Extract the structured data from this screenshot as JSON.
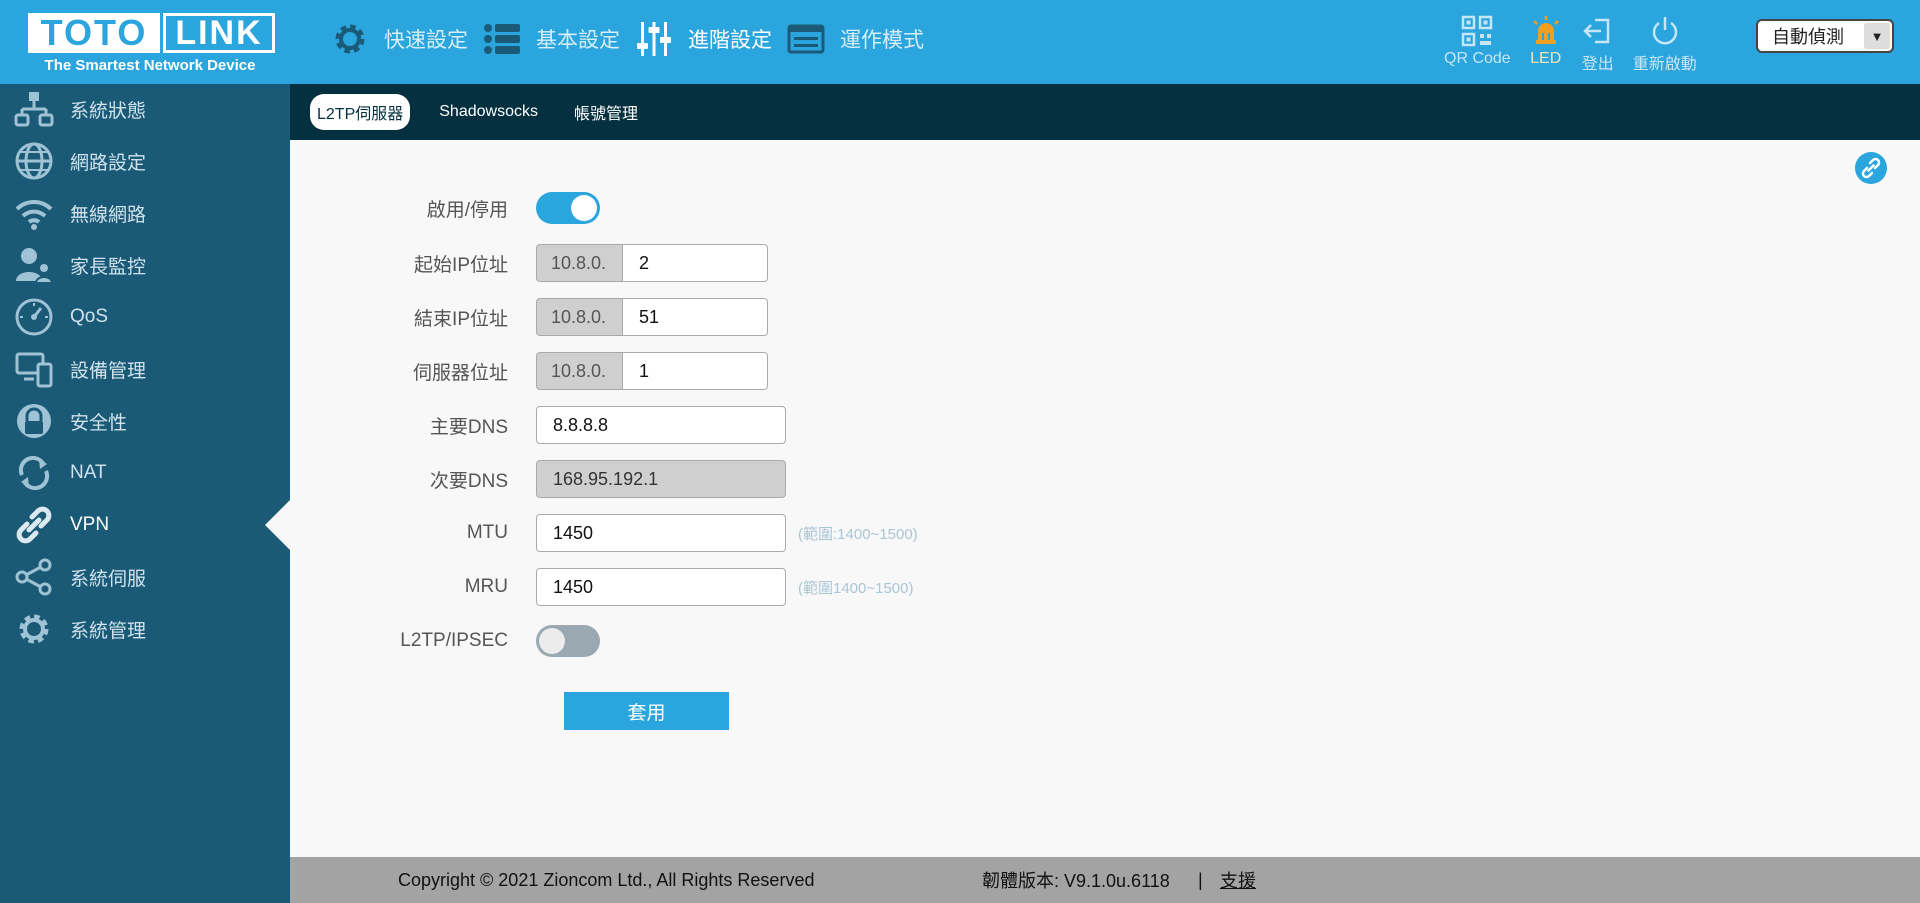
{
  "header": {
    "logo_left": "TOTO",
    "logo_right": "LINK",
    "tagline": "The Smartest Network Device",
    "nav": [
      {
        "label": "快速設定",
        "icon": "gear-icon"
      },
      {
        "label": "基本設定",
        "icon": "list-icon"
      },
      {
        "label": "進階設定",
        "icon": "sliders-icon"
      },
      {
        "label": "運作模式",
        "icon": "router-mode-icon"
      }
    ],
    "tools": [
      {
        "label": "QR Code",
        "icon": "qrcode-icon"
      },
      {
        "label": "LED",
        "icon": "led-icon"
      },
      {
        "label": "登出",
        "icon": "logout-icon"
      },
      {
        "label": "重新啟動",
        "icon": "power-icon"
      }
    ],
    "language": "自動偵測"
  },
  "sidebar": {
    "items": [
      {
        "label": "系統狀態",
        "icon": "network-status-icon"
      },
      {
        "label": "網路設定",
        "icon": "globe-icon"
      },
      {
        "label": "無線網路",
        "icon": "wifi-icon"
      },
      {
        "label": "家長監控",
        "icon": "parental-control-icon"
      },
      {
        "label": "QoS",
        "icon": "speedometer-icon"
      },
      {
        "label": "設備管理",
        "icon": "devices-icon"
      },
      {
        "label": "安全性",
        "icon": "lock-icon"
      },
      {
        "label": "NAT",
        "icon": "refresh-icon"
      },
      {
        "label": "VPN",
        "icon": "link-icon"
      },
      {
        "label": "系統伺服",
        "icon": "share-icon"
      },
      {
        "label": "系統管理",
        "icon": "settings-icon"
      }
    ],
    "active_index": 8
  },
  "tabs": [
    {
      "label": "L2TP伺服器"
    },
    {
      "label": "Shadowsocks"
    },
    {
      "label": "帳號管理"
    }
  ],
  "form": {
    "enable_label": "啟用/停用",
    "enable_on": true,
    "start_ip_label": "起始IP位址",
    "start_ip_prefix": "10.8.0.",
    "start_ip_value": "2",
    "end_ip_label": "結束IP位址",
    "end_ip_prefix": "10.8.0.",
    "end_ip_value": "51",
    "server_ip_label": "伺服器位址",
    "server_ip_prefix": "10.8.0.",
    "server_ip_value": "1",
    "primary_dns_label": "主要DNS",
    "primary_dns_value": "8.8.8.8",
    "secondary_dns_label": "次要DNS",
    "secondary_dns_value": "168.95.192.1",
    "mtu_label": "MTU",
    "mtu_value": "1450",
    "mtu_hint": "(範圍:1400~1500)",
    "mru_label": "MRU",
    "mru_value": "1450",
    "mru_hint": "(範圍1400~1500)",
    "ipsec_label": "L2TP/IPSEC",
    "ipsec_on": false,
    "apply_label": "套用"
  },
  "footer": {
    "copyright": "Copyright © 2021 Zioncom Ltd., All Rights Reserved",
    "firmware": "韌體版本: V9.1.0u.6118",
    "separator": "|",
    "support": "支援"
  },
  "colors": {
    "header_bg": "#2aa5dd",
    "sidebar_bg": "#1b5a77",
    "subtab_bg": "#05303f",
    "accent": "#2aa5dd",
    "led_icon": "#f0a020"
  }
}
